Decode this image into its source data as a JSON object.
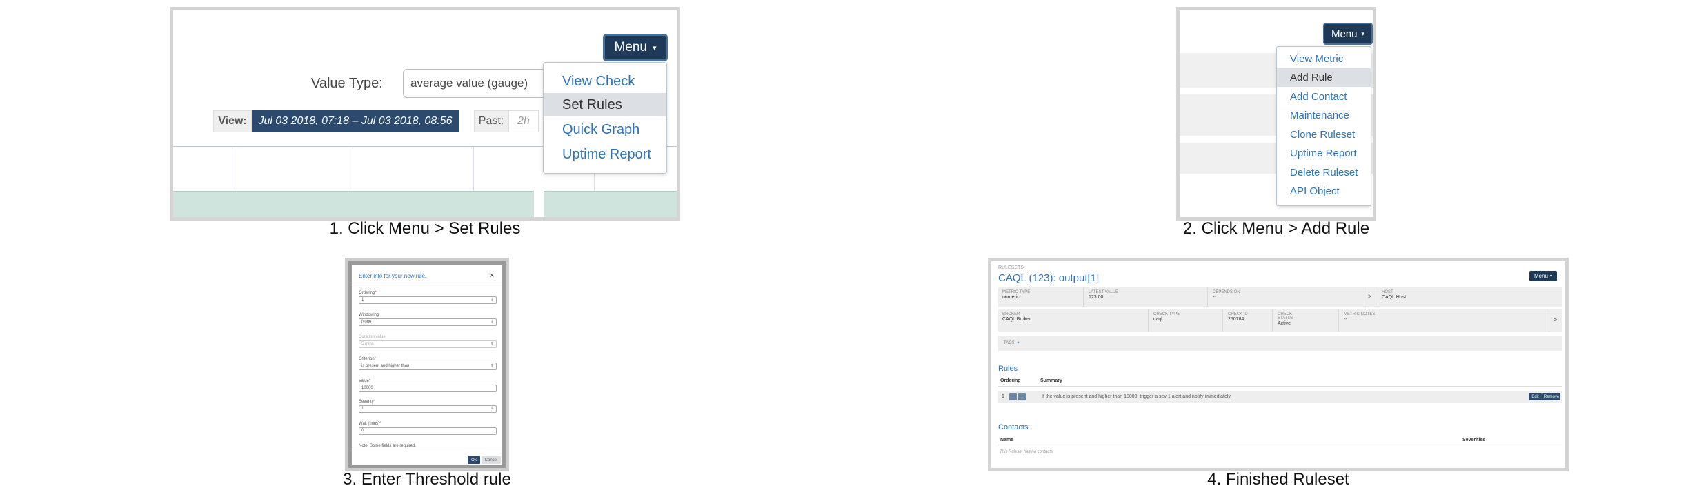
{
  "captions": {
    "step1": "1. Click Menu > Set Rules",
    "step2": "2. Click Menu > Add Rule",
    "step3": "3. Enter Threshold rule",
    "step4": "4. Finished Ruleset"
  },
  "panel1": {
    "menu_label": "Menu",
    "menu_caret": "▾",
    "value_type_label": "Value Type:",
    "value_type_value": "average value (gauge)",
    "view_label": "View:",
    "view_range": "Jul 03 2018, 07:18  –  Jul 03 2018, 08:56",
    "past_label": "Past:",
    "past_placeholder": "2h",
    "menu_items": [
      "View Check",
      "Set Rules",
      "Quick Graph",
      "Uptime Report"
    ],
    "active_item": "Set Rules"
  },
  "panel2": {
    "menu_label": "Menu",
    "menu_caret": "▾",
    "menu_items": [
      "View Metric",
      "Add Rule",
      "Add Contact",
      "Maintenance",
      "Clone Ruleset",
      "Uptime Report",
      "Delete Ruleset",
      "API Object"
    ],
    "active_item": "Add Rule"
  },
  "panel3": {
    "title": "Enter info for your new rule.",
    "close": "×",
    "fields": {
      "ordering": {
        "label": "Ordering",
        "value": "1"
      },
      "windowing": {
        "label": "Windowing",
        "value": "None"
      },
      "duration": {
        "label": "Duration value",
        "value": "5 mins"
      },
      "criterion": {
        "label": "Criterion",
        "value": "is present and higher than"
      },
      "value": {
        "label": "Value",
        "value": "10000"
      },
      "severity": {
        "label": "Severity",
        "value": "1"
      },
      "wait": {
        "label": "Wait (mins)",
        "value": "0"
      }
    },
    "required_mark": "*",
    "select_caret": "⇕",
    "note": "Note: Some fields are required.",
    "ok": "Ok",
    "cancel": "Cancel"
  },
  "panel4": {
    "breadcrumb": "RULESETS",
    "title": "CAQL (123): output[1]",
    "menu_label": "Menu",
    "menu_caret": "▾",
    "row1": {
      "metric_type": {
        "k": "Metric Type",
        "v": "numeric"
      },
      "latest_value": {
        "k": "Latest Value",
        "v": "123.00"
      },
      "depends_on": {
        "k": "Depends On",
        "v": "--"
      },
      "host": {
        "k": "Host",
        "v": "CAQL Host"
      }
    },
    "row2": {
      "broker": {
        "k": "Broker",
        "v": "CAQL Broker"
      },
      "check_type": {
        "k": "Check Type",
        "v": "caql"
      },
      "check_id": {
        "k": "Check ID",
        "v": "250784"
      },
      "check_status": {
        "k": "Check Status",
        "v": "Active"
      },
      "metric_notes": {
        "k": "Metric Notes",
        "v": "--"
      }
    },
    "chevron": ">",
    "tags": "TAGS:",
    "tags_add": "+",
    "rules_heading": "Rules",
    "rules_cols": {
      "ordering": "Ordering",
      "summary": "Summary"
    },
    "rule": {
      "ordering": "1",
      "up": "↑",
      "down": "↓",
      "summary": "If the value is present and higher than 10000, trigger a sev 1 alert and notify immediately.",
      "edit": "Edit",
      "remove": "Remove"
    },
    "contacts_heading": "Contacts",
    "contacts_cols": {
      "name": "Name",
      "severities": "Severities"
    },
    "contacts_empty": "This Ruleset has no contacts."
  }
}
